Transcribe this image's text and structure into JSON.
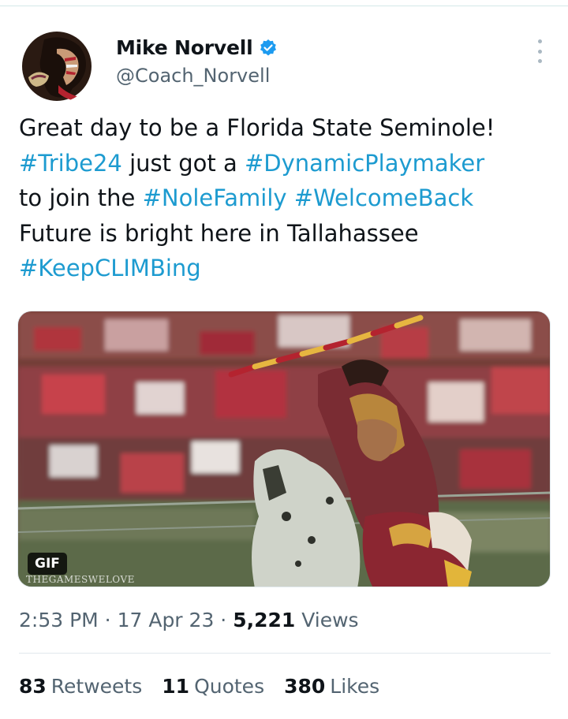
{
  "author": {
    "display_name": "Mike Norvell",
    "handle": "@Coach_Norvell",
    "verified": true,
    "avatar_icon": "seminoles-logo-icon"
  },
  "tweet": {
    "lines": [
      [
        {
          "text": "Great day to be a Florida State Seminole!",
          "hashtag": false
        }
      ],
      [
        {
          "text": "#Tribe24",
          "hashtag": true
        },
        {
          "text": " just got a ",
          "hashtag": false
        },
        {
          "text": "#DynamicPlaymaker",
          "hashtag": true
        }
      ],
      [
        {
          "text": "to join the ",
          "hashtag": false
        },
        {
          "text": "#NoleFamily",
          "hashtag": true
        },
        {
          "text": " ",
          "hashtag": false
        },
        {
          "text": "#WelcomeBack",
          "hashtag": true
        }
      ],
      [
        {
          "text": "Future is bright here in Tallahassee",
          "hashtag": false
        }
      ],
      [
        {
          "text": "#KeepCLIMBing",
          "hashtag": true
        }
      ]
    ]
  },
  "media": {
    "badge": "GIF",
    "watermark": "THEGAMESWELOVE"
  },
  "meta": {
    "time": "2:53 PM",
    "sep1": " · ",
    "date": "17 Apr 23",
    "sep2": " · ",
    "views_count": "5,221",
    "views_label": " Views"
  },
  "stats": {
    "retweets_count": "83",
    "retweets_label": "Retweets",
    "quotes_count": "11",
    "quotes_label": "Quotes",
    "likes_count": "380",
    "likes_label": "Likes"
  },
  "colors": {
    "hashtag": "#1d9bd0",
    "verified": "#1d9bf0",
    "secondary_text": "#536471",
    "garnet": "#782f40",
    "gold": "#ceb888"
  }
}
